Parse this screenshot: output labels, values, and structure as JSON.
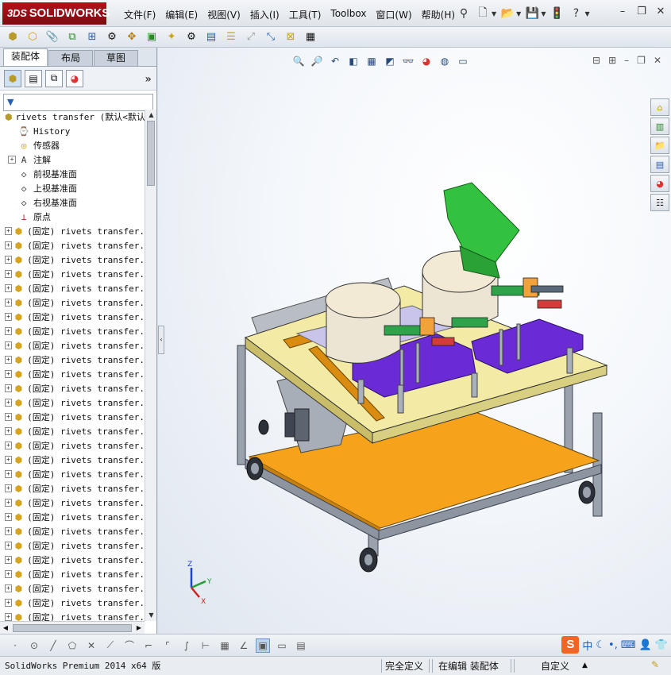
{
  "app": {
    "logo_text": "SOLIDWORKS",
    "logo_prefix": "3DS"
  },
  "menu": [
    "文件(F)",
    "编辑(E)",
    "视图(V)",
    "插入(I)",
    "工具(T)",
    "Toolbox",
    "窗口(W)",
    "帮助(H)"
  ],
  "sidebar": {
    "tabs": [
      "装配体",
      "布局",
      "草图"
    ],
    "root_label": "rivets transfer  (默认<默认",
    "feature_items": [
      {
        "label": "History",
        "icon": "history-icon"
      },
      {
        "label": "传感器",
        "icon": "sensor-icon"
      },
      {
        "label": "注解",
        "icon": "annotation-icon"
      },
      {
        "label": "前视基准面",
        "icon": "plane-icon"
      },
      {
        "label": "上视基准面",
        "icon": "plane-icon"
      },
      {
        "label": "右视基准面",
        "icon": "plane-icon"
      },
      {
        "label": "原点",
        "icon": "origin-icon"
      }
    ],
    "component_label": "(固定) rivets transfer.",
    "component_count": 28
  },
  "colors": {
    "brand_red": "#b3121b",
    "purple_plate": "#6a2bd6",
    "orange_shelf": "#f7a21b",
    "table_top": "#f3eaa5",
    "green_hopper": "#33c240",
    "axis_x": "#d02020",
    "axis_y": "#20a030",
    "axis_z": "#2040d0"
  },
  "viewport": {
    "triad": {
      "x": "X",
      "y": "Y",
      "z": "Z"
    }
  },
  "status": {
    "version": "SolidWorks Premium 2014 x64 版",
    "state": "完全定义",
    "mode": "在编辑 装配体",
    "units": "自定义"
  },
  "ime": {
    "brand": "S",
    "lang": "中"
  }
}
